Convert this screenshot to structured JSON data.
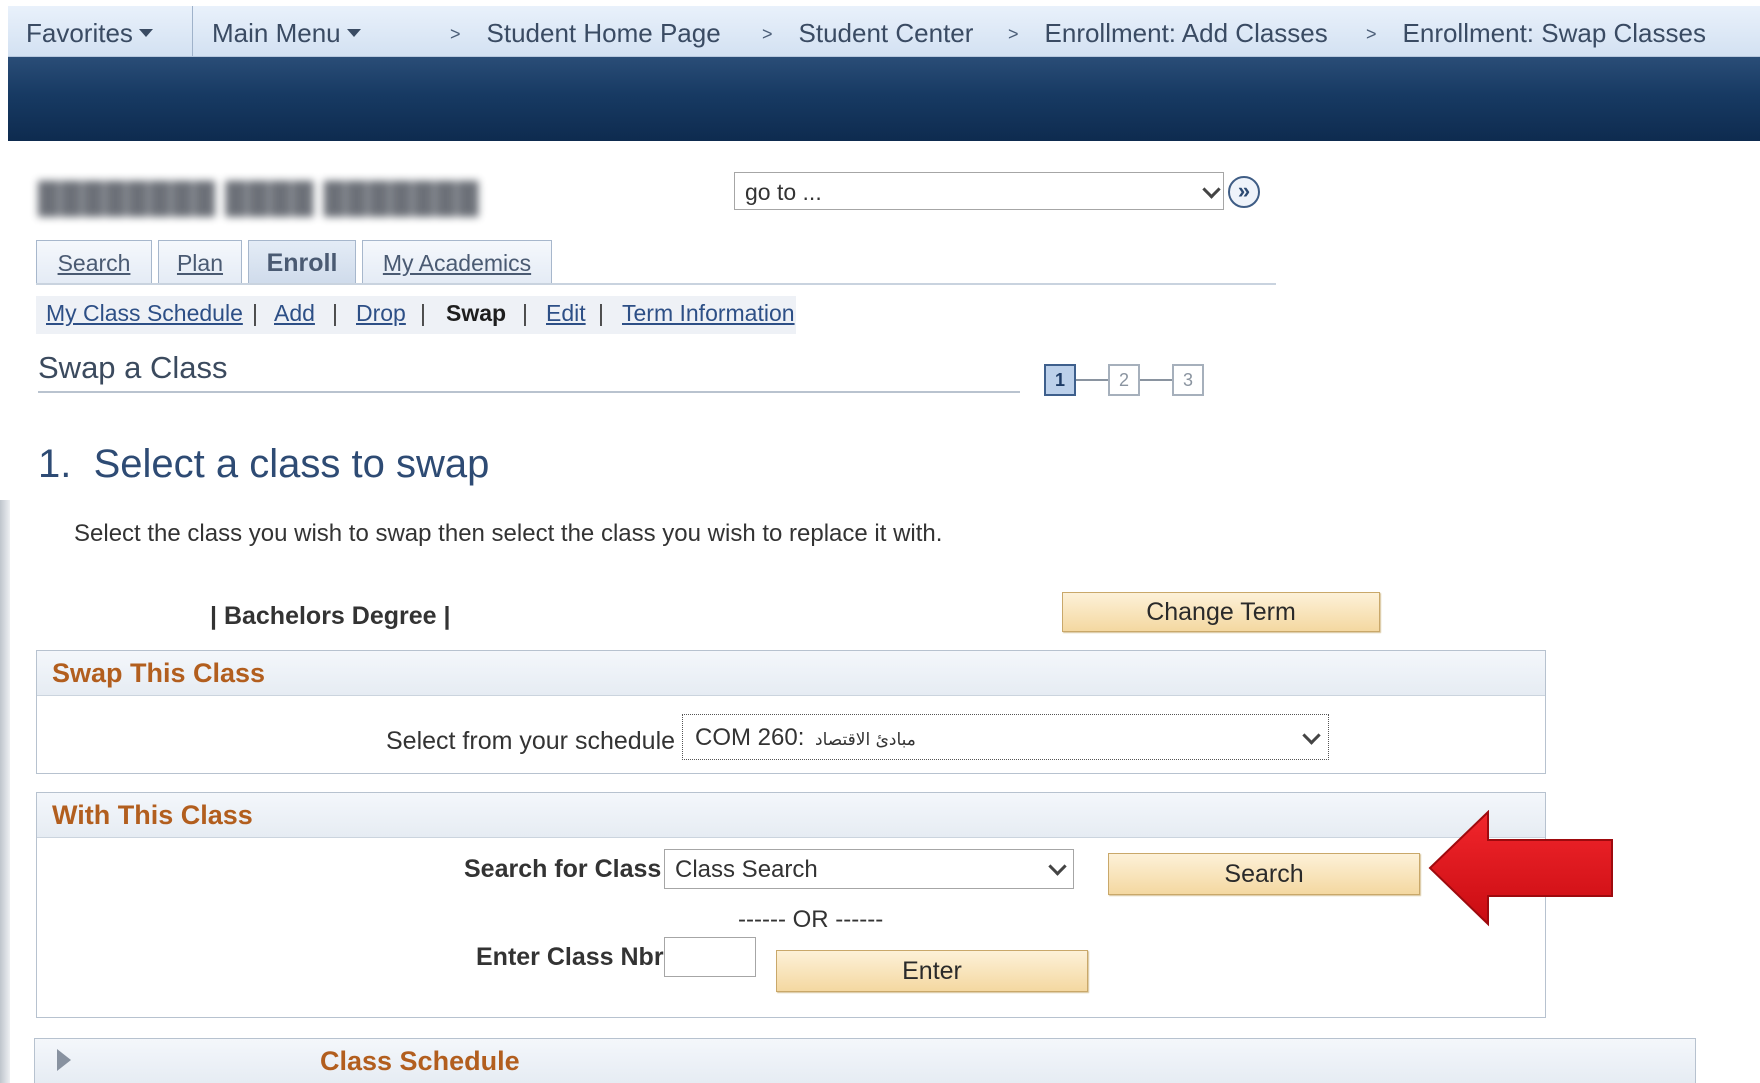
{
  "topnav": {
    "favorites": "Favorites",
    "main_menu": "Main Menu",
    "breadcrumbs": [
      "Student Home Page",
      "Student Center",
      "Enrollment: Add Classes",
      "Enrollment: Swap Classes"
    ]
  },
  "header": {
    "goto_value": "go to ...",
    "goto_btn_glyph": "»"
  },
  "tabs": [
    "Search",
    "Plan",
    "Enroll",
    "My Academics"
  ],
  "active_tab": "Enroll",
  "subnav": {
    "items": [
      "My Class Schedule",
      "Add",
      "Drop",
      "Swap",
      "Edit",
      "Term Information"
    ],
    "current": "Swap"
  },
  "page_title": "Swap a Class",
  "steps": {
    "labels": [
      "1",
      "2",
      "3"
    ],
    "current": 1
  },
  "step_heading": "1.  Select a class to swap",
  "instructions": "Select the class you wish to swap then select the class you wish to replace it with.",
  "career": "| Bachelors Degree |",
  "change_term_label": "Change Term",
  "swap_section": {
    "title": "Swap This Class",
    "select_label": "Select from your schedule",
    "selected_code": "COM 260:",
    "selected_name": "مبادئ الاقتصاد"
  },
  "with_section": {
    "title": "With This Class",
    "search_label": "Search for Class",
    "search_select_value": "Class Search",
    "search_button": "Search",
    "or_text": "------ OR ------",
    "class_nbr_label": "Enter Class Nbr",
    "class_nbr_value": "",
    "enter_button": "Enter"
  },
  "class_schedule_title": "Class Schedule",
  "colors": {
    "section_title": "#b25e1e",
    "banner": "#173a63",
    "button": "#f4d8a1",
    "annotation_arrow": "#e3141b"
  }
}
